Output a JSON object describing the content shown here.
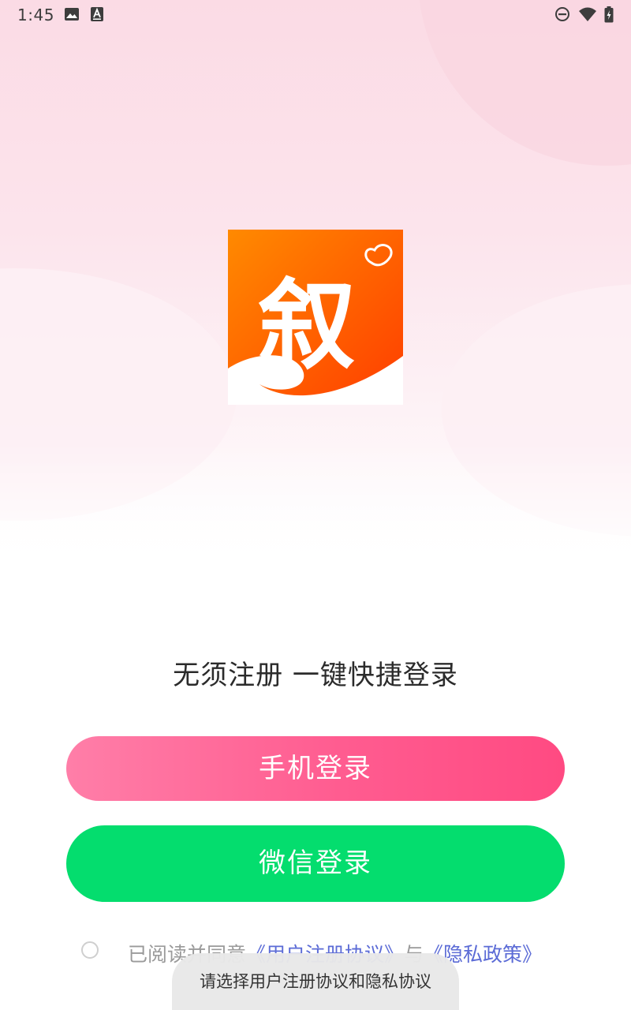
{
  "status_bar": {
    "time": "1:45",
    "icons": [
      "image-icon",
      "text-a-icon",
      "do-not-disturb-icon",
      "wifi-icon",
      "battery-icon"
    ]
  },
  "logo": {
    "glyph": "叙",
    "name": "app-logo",
    "colors": {
      "start": "#ff8a00",
      "end": "#ff3d00"
    }
  },
  "tagline": "无须注册 一键快捷登录",
  "buttons": {
    "phone_login": "手机登录",
    "wechat_login": "微信登录"
  },
  "agreement": {
    "prefix": "已阅读并同意",
    "user_agreement": "《用户注册协议》",
    "connector": "与",
    "privacy_policy": "《隐私政策》",
    "checked": false
  },
  "toast": "请选择用户注册协议和隐私协议",
  "colors": {
    "phone_button": "#ff5c90",
    "wechat_button": "#04dd6e",
    "link": "#5b6bd6"
  }
}
